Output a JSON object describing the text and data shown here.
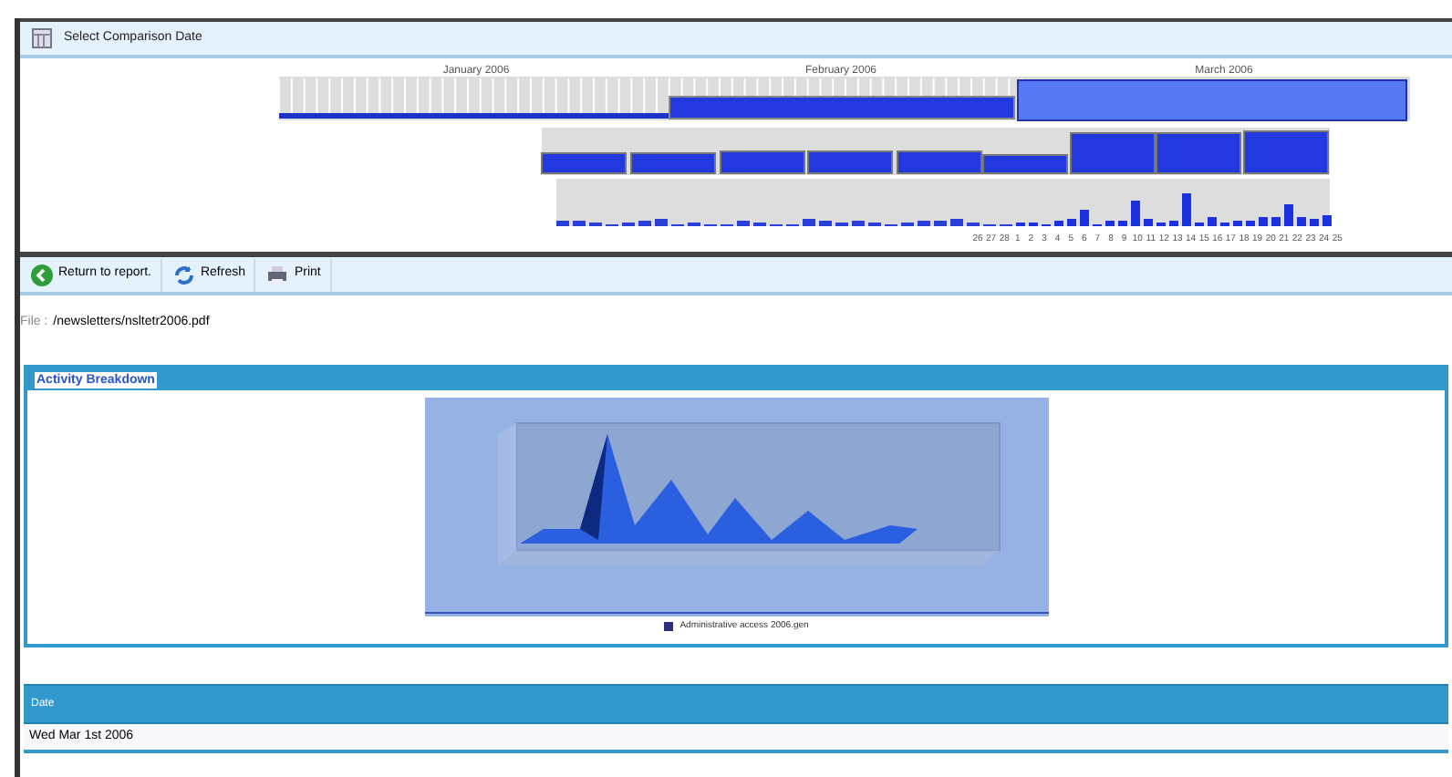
{
  "comparison_header": {
    "title": "Select Comparison Date"
  },
  "timeline": {
    "months": [
      "January 2006",
      "February 2006",
      "March 2006"
    ],
    "day_labels": [
      "26",
      "27",
      "28",
      "1",
      "2",
      "3",
      "4",
      "5",
      "6",
      "7",
      "8",
      "9",
      "10",
      "11",
      "12",
      "13",
      "14",
      "15",
      "16",
      "17",
      "18",
      "19",
      "20",
      "21",
      "22",
      "23",
      "24",
      "25"
    ]
  },
  "toolbar": {
    "buttons": [
      {
        "kind": "back",
        "label": "Return to report."
      },
      {
        "kind": "refresh",
        "label": "Refresh"
      },
      {
        "kind": "print",
        "label": "Print"
      }
    ]
  },
  "file": {
    "label": "File :",
    "path": "/newsletters/nsltetr2006.pdf"
  },
  "activity_panel": {
    "title": "Activity Breakdown",
    "legend": "Administrative access 2006.gen"
  },
  "table": {
    "columns": [
      "Date"
    ],
    "rows": [
      [
        "Wed Mar 1st 2006"
      ]
    ]
  }
}
